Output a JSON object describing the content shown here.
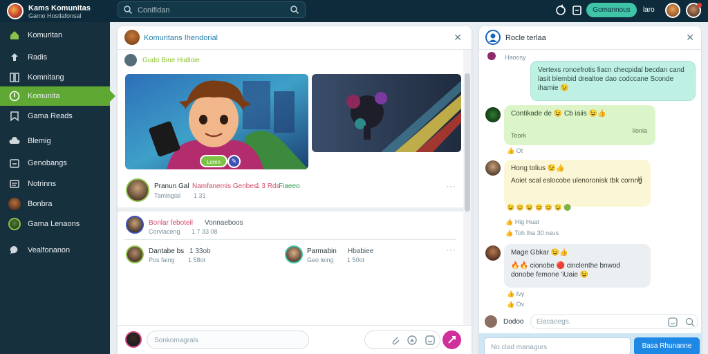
{
  "topbar": {
    "brand_title": "Kams Komunitas",
    "brand_subtitle": "Gamo Hostlafonsal",
    "search_placeholder": "Conifidan",
    "action_button": "Gomannous",
    "user_name": "laro",
    "icons": [
      "search-icon",
      "refresh-icon",
      "copy-icon",
      "avatar"
    ]
  },
  "sidebar": {
    "active_color": "#5fa833",
    "items": [
      {
        "label": "Komuritan",
        "icon": "home-icon"
      },
      {
        "label": "Radis",
        "icon": "upload-icon"
      },
      {
        "label": "Komnitang",
        "icon": "book-icon"
      },
      {
        "label": "Komunita",
        "icon": "compass-icon",
        "active": true
      },
      {
        "label": "Gama Reads",
        "icon": "bookmark-icon"
      },
      {
        "label": "Blemig",
        "icon": "cloud-icon"
      },
      {
        "label": "Genobangs",
        "icon": "calendar-icon"
      },
      {
        "label": "Notrinns",
        "icon": "list-icon"
      },
      {
        "label": "Bonbra",
        "icon": "avatar"
      },
      {
        "label": "Gama Lenaons",
        "icon": "avatar"
      },
      {
        "label": "Vealfonanon",
        "icon": "chat-icon"
      }
    ]
  },
  "feed": {
    "title": "Komuritans Ihendorial",
    "post_author": "Gudo Bine Hialloie",
    "image_badge": "Lomn",
    "post_row": {
      "name": "Pranun Gal",
      "highlight": "Namfanemis Genbes",
      "extra": "1 3 Rds",
      "link": "Fiaeeo",
      "meta1": "Tamingial",
      "meta2": "1 31"
    },
    "comment_row": {
      "name": "Bonlar feboteil",
      "text": "Vonnaeboos",
      "meta1": "Corvlaceng",
      "meta2": "1 7 33 08"
    },
    "users": [
      {
        "name": "Dantabe bs",
        "extra": "1 33ob",
        "meta1": "Pos faing",
        "meta2": "1 58ot"
      },
      {
        "name": "Parmabin",
        "extra": "Hbabiee",
        "meta1": "Geo leing",
        "meta2": "1 50ot"
      }
    ],
    "composer_placeholder": "Sonkomagrals",
    "accent_color": "#d0309a"
  },
  "chat": {
    "title": "Rocle terlaa",
    "top_meta": "Haoosy",
    "messages": [
      {
        "type": "sent",
        "text": "Vertexs roncefrotis fiacn checpidal becdan cand lasit blembid drealtoe dao codccane Sconde ihamie 😉"
      },
      {
        "type": "green",
        "title": "Contikade de 😉 Cb iaiis 😉👍",
        "sub": "Toork",
        "time": "Iionia",
        "meta": "👍 Ot"
      },
      {
        "type": "yellow",
        "title": "Hong tolius 😉👍",
        "text": "Aoiet scal eslocobe ulenoronisk tbk cornng",
        "time": "Ifl",
        "meta": "👍 Hig   Huat",
        "meta2": "👍 Toh   Iha 30 nsus",
        "reacts": "😉 😊 😉 😊 😊 😉 🟢"
      },
      {
        "type": "grey",
        "title": "Mage Gbkar 😉👍",
        "text": "🔥🔥 cionobe 🔴 cinclenthe bnwod donobe femone 'iUaie 😉",
        "meta": "👍 Ivy",
        "meta2": "👍 Ov"
      }
    ],
    "typing_name": "Dodoo",
    "typing_placeholder": "Eiacaoegs.",
    "message_placeholder": "No clad managurs",
    "send_label": "Basa Rhunanne"
  }
}
